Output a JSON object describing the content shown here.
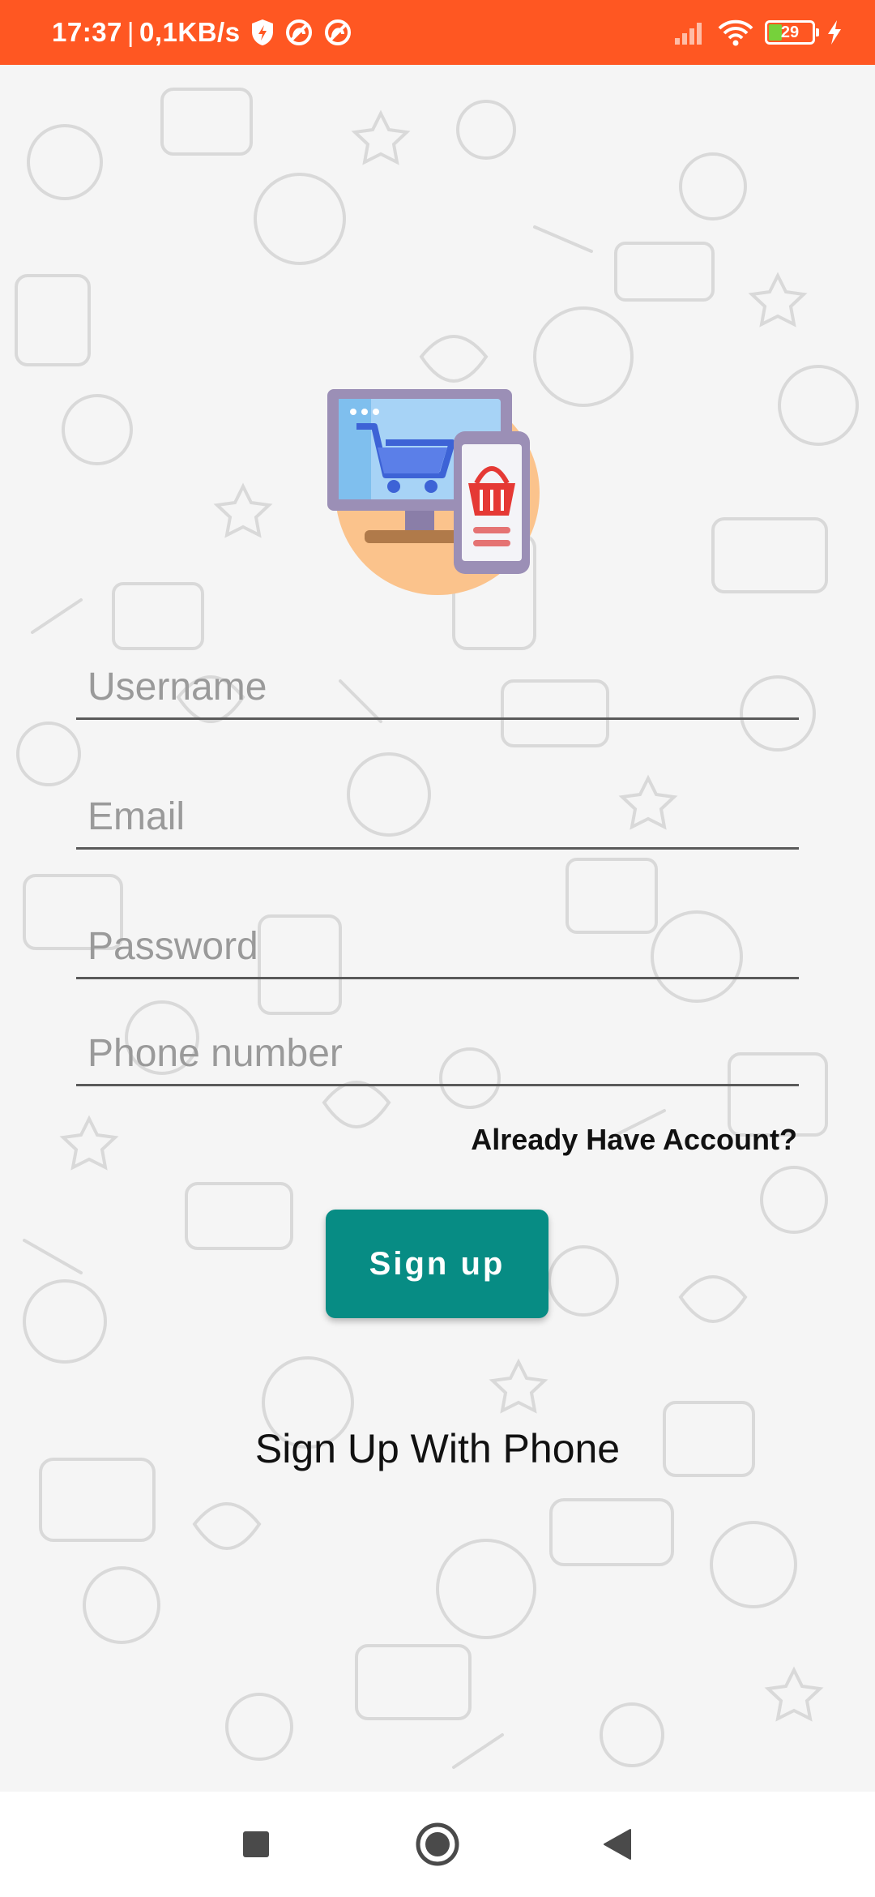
{
  "status_bar": {
    "time": "17:37",
    "separator": "|",
    "speed": "0,1KB/s",
    "battery_level": "29",
    "battery_fraction": 0.29,
    "background_color": "#ff5722"
  },
  "logo": {
    "icon": "shop-desktop-cart-mobile-basket-icon"
  },
  "form": {
    "username_placeholder": "Username",
    "email_placeholder": "Email",
    "password_placeholder": "Password",
    "phone_placeholder": "Phone number"
  },
  "links": {
    "already_have_account": "Already Have Account?",
    "sign_up_with_phone": "Sign Up With Phone"
  },
  "buttons": {
    "sign_up": "Sign up",
    "sign_up_color": "#078c84"
  },
  "nav": {
    "recents": "square-icon",
    "home": "circle-icon",
    "back": "triangle-back-icon"
  }
}
